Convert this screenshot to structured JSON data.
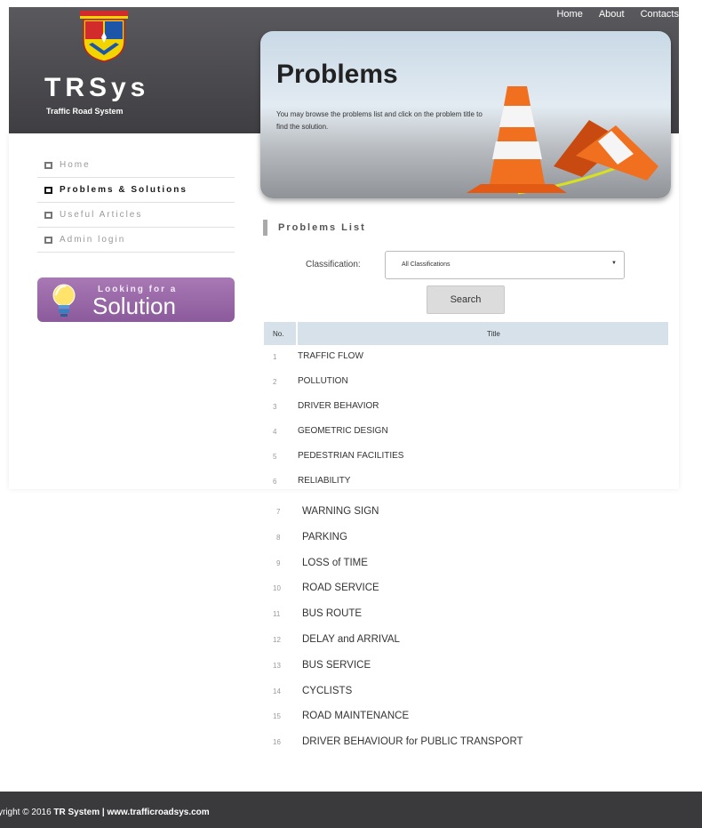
{
  "nav": {
    "top_links": [
      "Home",
      "About",
      "Contacts"
    ]
  },
  "logo": {
    "title": "TRSys",
    "subtitle": "Traffic Road System"
  },
  "banner": {
    "title": "Problems",
    "description": "You may browse the problems list and click on the problem title to find the solution."
  },
  "sidebar": {
    "items": [
      {
        "label": "Home",
        "active": false
      },
      {
        "label": "Problems & Solutions",
        "active": true
      },
      {
        "label": "Useful Articles",
        "active": false
      },
      {
        "label": "Admin login",
        "active": false
      }
    ]
  },
  "promo": {
    "small": "Looking for a",
    "big": "Solution"
  },
  "main": {
    "section_title": "Problems List",
    "classification_label": "Classification:",
    "classification_value": "All Classifications",
    "search_label": "Search",
    "table": {
      "headers": [
        "No.",
        "Title"
      ],
      "rows": [
        {
          "no": "1",
          "title": "TRAFFIC FLOW"
        },
        {
          "no": "2",
          "title": "POLLUTION"
        },
        {
          "no": "3",
          "title": "DRIVER BEHAVIOR"
        },
        {
          "no": "4",
          "title": "GEOMETRIC DESIGN"
        },
        {
          "no": "5",
          "title": "PEDESTRIAN FACILITIES"
        },
        {
          "no": "6",
          "title": "RELIABILITY"
        },
        {
          "no": "7",
          "title": "WARNING SIGN"
        },
        {
          "no": "8",
          "title": "PARKING"
        },
        {
          "no": "9",
          "title": "LOSS of TIME"
        },
        {
          "no": "10",
          "title": "ROAD SERVICE"
        },
        {
          "no": "11",
          "title": "BUS ROUTE"
        },
        {
          "no": "12",
          "title": "DELAY and ARRIVAL"
        },
        {
          "no": "13",
          "title": "BUS SERVICE"
        },
        {
          "no": "14",
          "title": "CYCLISTS"
        },
        {
          "no": "15",
          "title": "ROAD MAINTENANCE"
        },
        {
          "no": "16",
          "title": "DRIVER BEHAVIOUR for PUBLIC TRANSPORT"
        }
      ]
    }
  },
  "footer": {
    "prefix": "yright © 2016 ",
    "company": "TR System",
    "separator": " | ",
    "website": "www.trafficroadsys.com"
  },
  "colors": {
    "header": "#4a494d",
    "promo": "#9b6aa9",
    "table_header": "#d6e1ea",
    "footer": "#3a3a3d",
    "cone": "#f07020"
  }
}
